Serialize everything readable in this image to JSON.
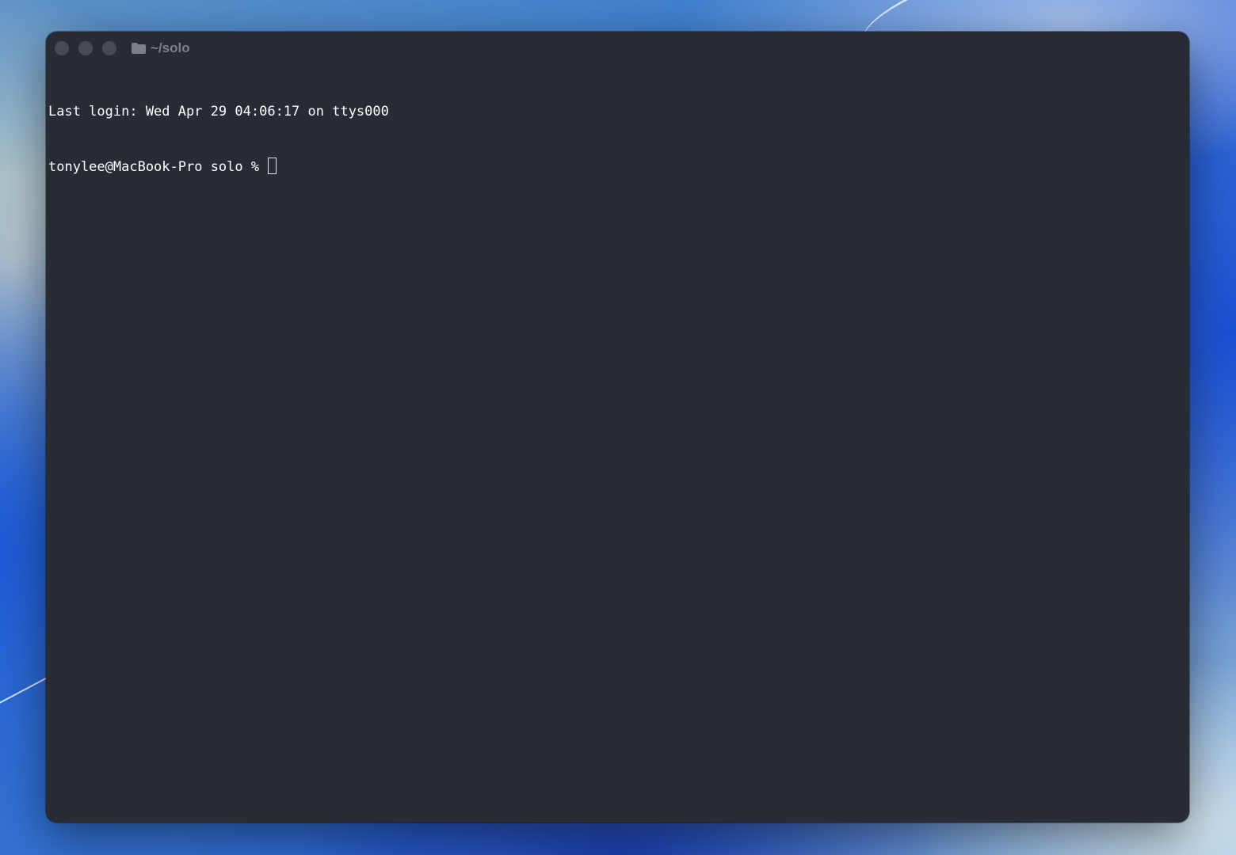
{
  "window": {
    "title": "~/solo"
  },
  "terminal": {
    "lines": [
      "Last login: Wed Apr 29 04:06:17 on ttys000"
    ],
    "prompt": "tonylee@MacBook-Pro solo % "
  },
  "colors": {
    "terminal_background": "#282c35",
    "terminal_text": "#ffffff",
    "traffic_light_inactive": "#474b53",
    "title_text": "#7c8089"
  },
  "icons": {
    "title_icon": "folder-icon"
  }
}
